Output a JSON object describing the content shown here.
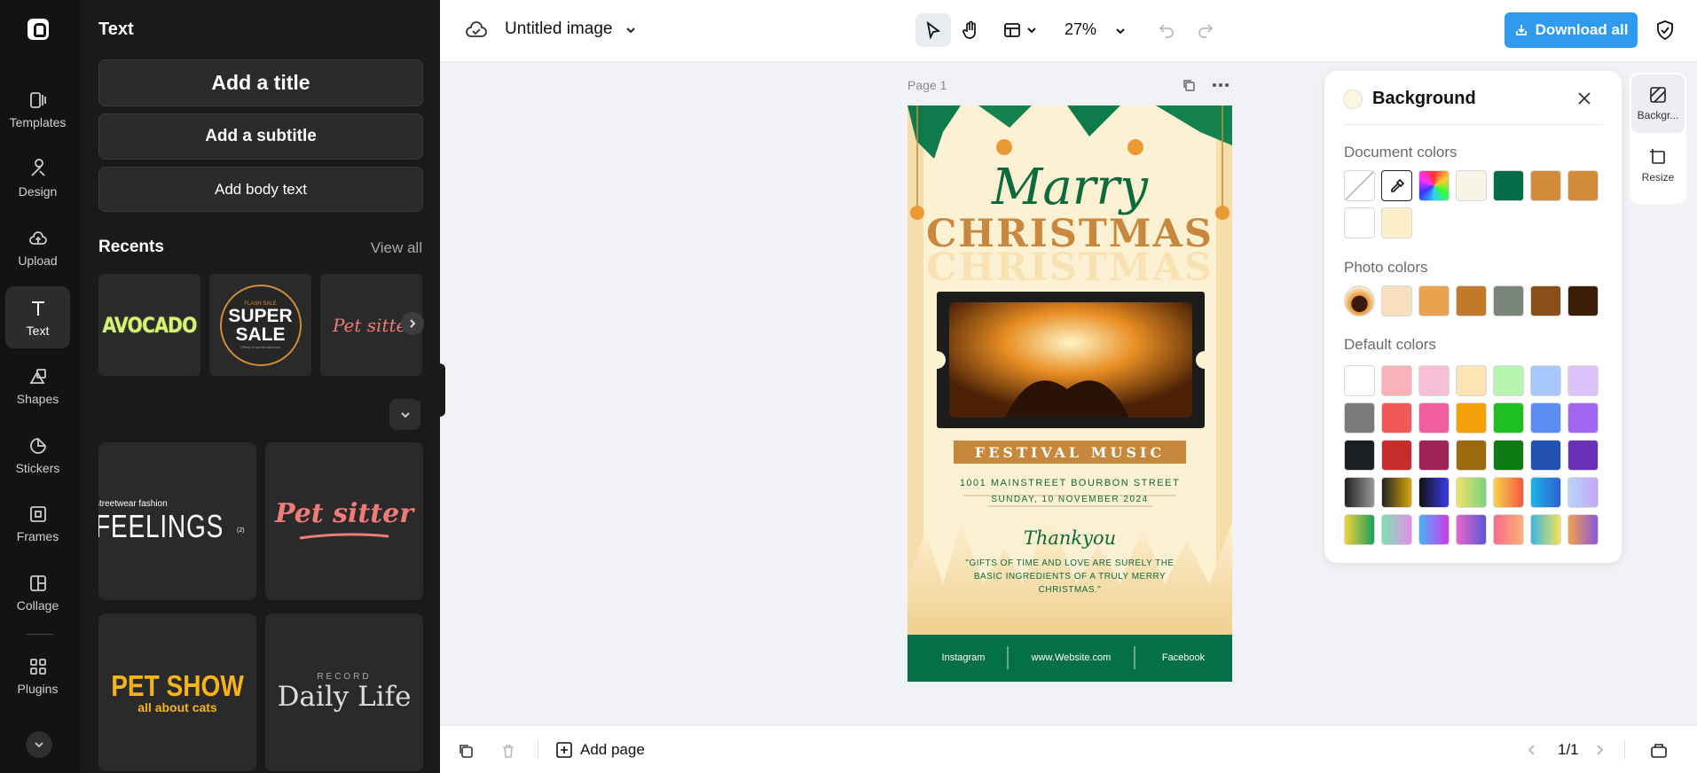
{
  "rail": {
    "items": [
      {
        "label": "Templates"
      },
      {
        "label": "Design"
      },
      {
        "label": "Upload"
      },
      {
        "label": "Text"
      },
      {
        "label": "Shapes"
      },
      {
        "label": "Stickers"
      },
      {
        "label": "Frames"
      },
      {
        "label": "Collage"
      },
      {
        "label": "Plugins"
      }
    ],
    "active": "Text"
  },
  "panel": {
    "title": "Text",
    "add_title": "Add a title",
    "add_subtitle": "Add a subtitle",
    "add_body": "Add body text",
    "recents_heading": "Recents",
    "view_all": "View all",
    "recents": [
      {
        "text": "AVOCADO"
      },
      {
        "small": "FLASH SALE",
        "line1": "SUPER",
        "line2": "SALE",
        "tiny": "Offers of special discount"
      },
      {
        "text": "Pet sitter"
      }
    ],
    "grid": [
      {
        "small": "streetwear fashion",
        "text": "FEELINGS",
        "sup": "(2)"
      },
      {
        "text": "Pet sitter"
      },
      {
        "line1": "PET SHOW",
        "line2": "all about cats"
      },
      {
        "small": "RECORD",
        "text": "Daily Life"
      }
    ]
  },
  "topbar": {
    "title": "Untitled image",
    "zoom": "27%",
    "download": "Download all"
  },
  "canvas": {
    "page_label": "Page 1"
  },
  "poster": {
    "script": "Marry",
    "headline": "CHRISTMAS",
    "headline_shadow": "CHRISTMAS",
    "banner": "FESTIVAL MUSIC",
    "address": "1001 MAINSTREET BOURBON STREET",
    "date": "SUNDAY, 10 NOVEMBER 2024",
    "thanks": "Thankyou",
    "quote": "\"GIFTS OF TIME AND LOVE ARE SURELY THE BASIC INGREDIENTS OF A TRULY MERRY CHRISTMAS.\"",
    "footer": [
      "Instagram",
      "www.Website.com",
      "Facebook"
    ]
  },
  "bottombar": {
    "add_page": "Add page",
    "pager": "1/1"
  },
  "background_panel": {
    "title": "Background",
    "document_colors_label": "Document colors",
    "photo_colors_label": "Photo colors",
    "default_colors_label": "Default colors",
    "document_colors": [
      "#f8f4e8",
      "#046c48",
      "#d18c3a",
      "#d18c3a",
      "#ffffff",
      "#fdefc8"
    ],
    "photo_colors": [
      "#f9e0bc",
      "#eaa24f",
      "#c2792a",
      "#7b8478",
      "#8b5019",
      "#3b1d08"
    ],
    "default_colors": [
      [
        "#ffffff",
        "#f9b3b8",
        "#f7bed8",
        "#fde4b5",
        "#b7f5b0",
        "#a8c7fb",
        "#dec3fb"
      ],
      [
        "#7a7a7a",
        "#ef5a57",
        "#f0609e",
        "#f7a10a",
        "#1fbf1f",
        "#5a8ef5",
        "#a366f3"
      ],
      [
        "#1b1e23",
        "#c82d2d",
        "#a02459",
        "#9b6b0e",
        "#0d7a13",
        "#2151b1",
        "#6b30b8"
      ]
    ],
    "gradients": [
      [
        "linear-gradient(90deg,#222,#999)",
        "linear-gradient(90deg,#222,#d6a70e)",
        "linear-gradient(90deg,#111,#3a3af0)",
        "linear-gradient(90deg,#f0e06a,#7fd27f)",
        "linear-gradient(90deg,#f7d34a,#f5573f)",
        "linear-gradient(90deg,#1cb6e8,#2f5fd0)",
        "linear-gradient(90deg,#b5d5f7,#c6a7f7)"
      ],
      [
        "linear-gradient(90deg,#f3d03a,#17a05c)",
        "linear-gradient(90deg,#7de1b4,#e38ee9)",
        "linear-gradient(90deg,#4cb1f7,#cc39e8)",
        "linear-gradient(90deg,#e768c8,#5c54d8)",
        "linear-gradient(90deg,#f86a89,#fbb17a)",
        "linear-gradient(90deg,#38b7e2,#f5e25a)",
        "linear-gradient(90deg,#f0a04e,#8a57d8)"
      ]
    ]
  },
  "side_tabs": [
    "Backgr...",
    "Resize"
  ]
}
